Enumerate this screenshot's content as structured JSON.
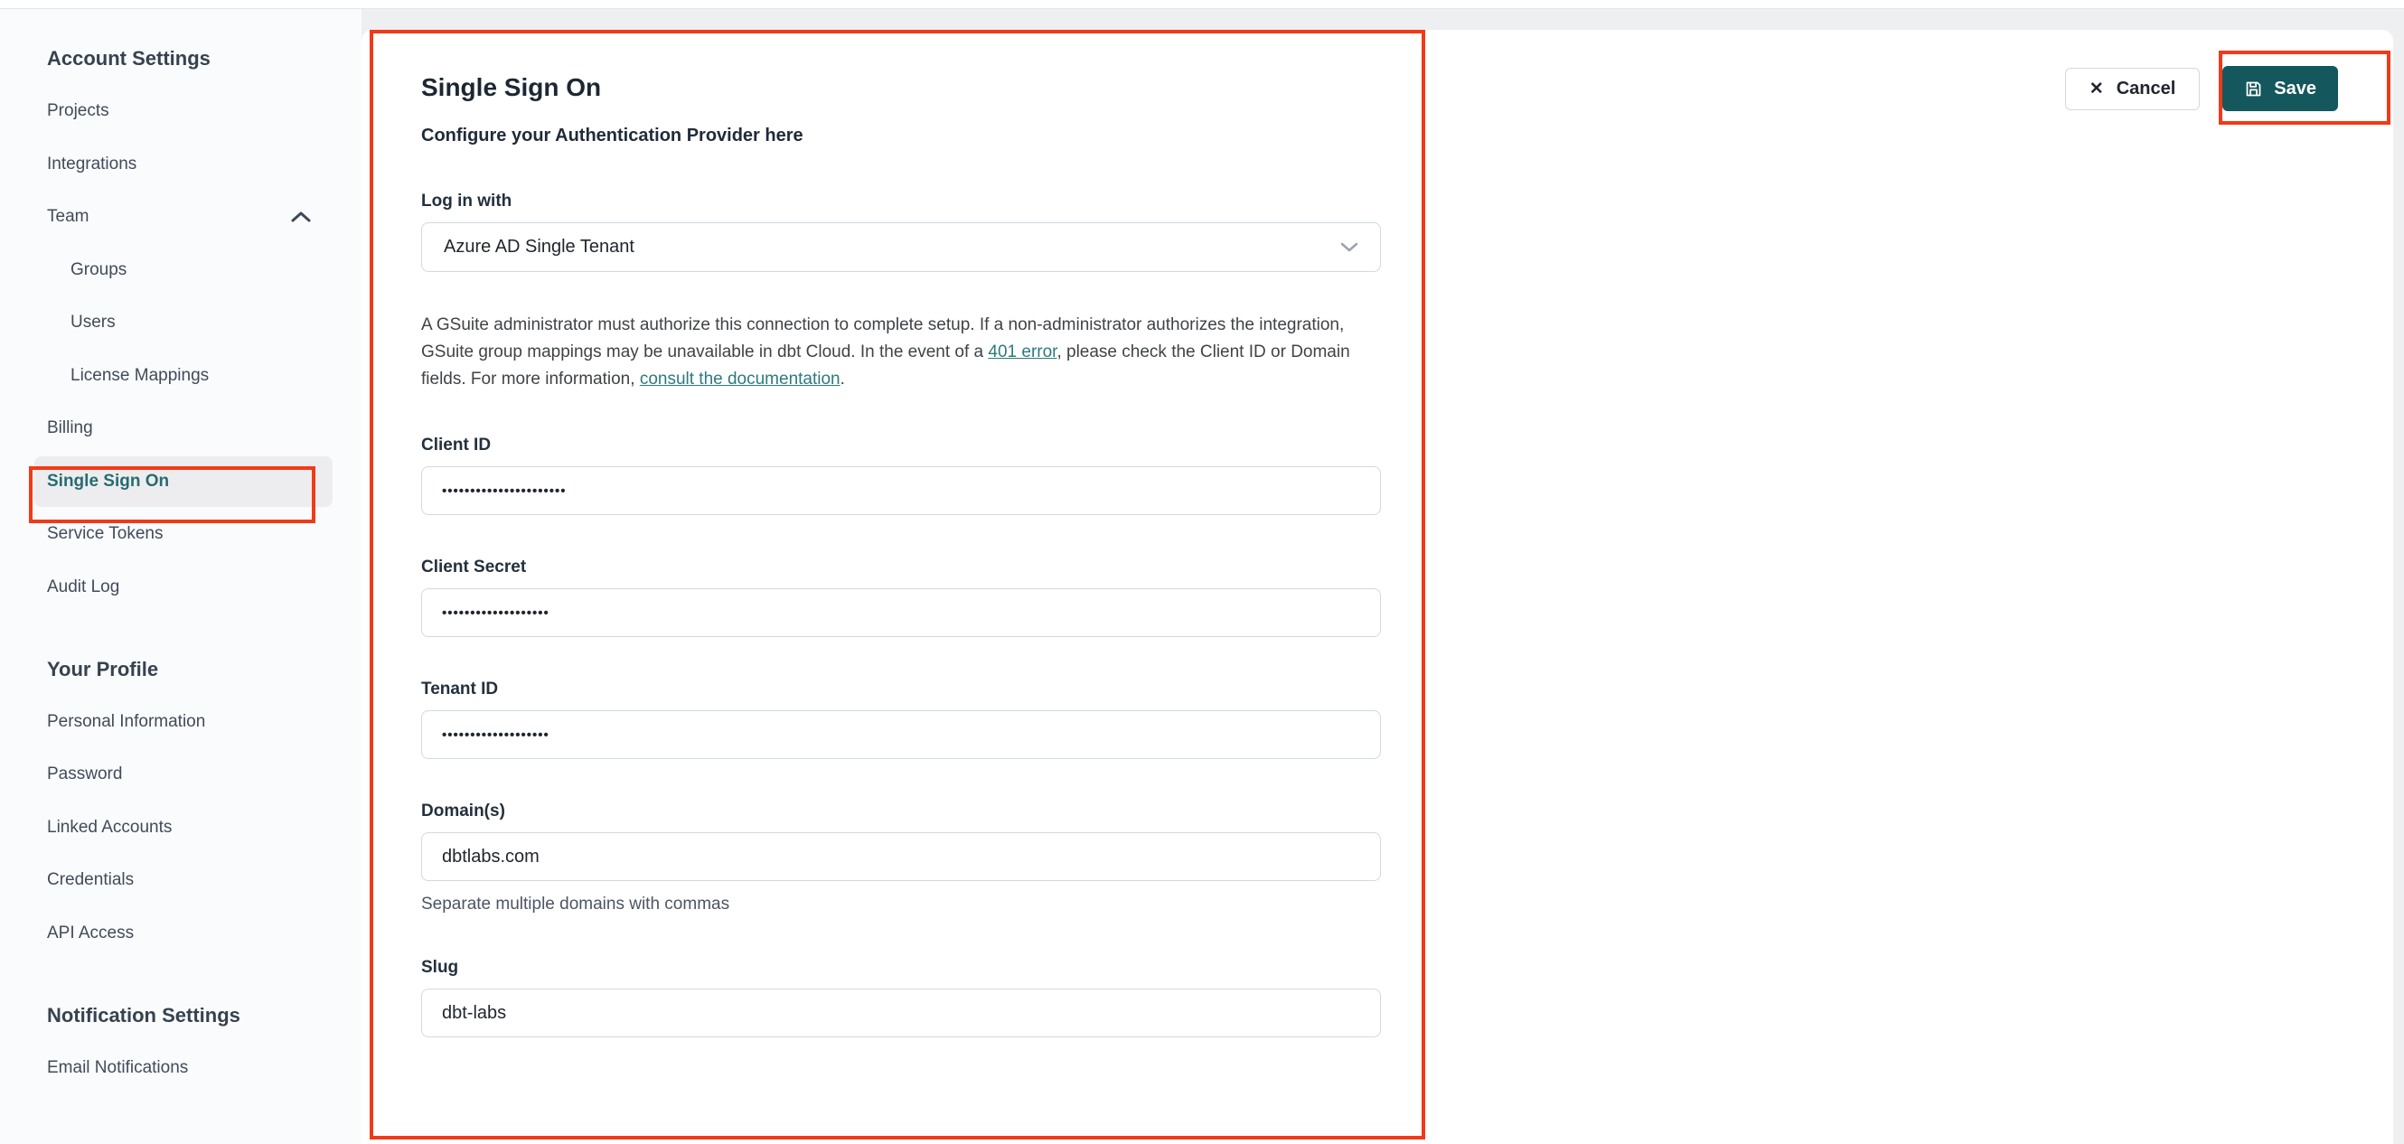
{
  "theme": {
    "accent_teal": "#266c71",
    "accent_dark_teal": "#14575c",
    "link_teal": "#2c7a7e",
    "annotation_red": "#f23a18",
    "page_bg": "#edeff1"
  },
  "sidebar": {
    "sections": [
      {
        "heading": "Account Settings",
        "items": [
          {
            "label": "Projects"
          },
          {
            "label": "Integrations"
          },
          {
            "label": "Team",
            "chevron": "up"
          },
          {
            "label": "Groups",
            "indent": true
          },
          {
            "label": "Users",
            "indent": true
          },
          {
            "label": "License Mappings",
            "indent": true
          },
          {
            "label": "Billing"
          },
          {
            "label": "Single Sign On",
            "active": true
          },
          {
            "label": "Service Tokens"
          },
          {
            "label": "Audit Log"
          }
        ]
      },
      {
        "heading": "Your Profile",
        "items": [
          {
            "label": "Personal Information"
          },
          {
            "label": "Password"
          },
          {
            "label": "Linked Accounts"
          },
          {
            "label": "Credentials"
          },
          {
            "label": "API Access"
          }
        ]
      },
      {
        "heading": "Notification Settings",
        "items": [
          {
            "label": "Email Notifications"
          }
        ]
      }
    ]
  },
  "main": {
    "title": "Single Sign On",
    "subtitle": "Configure your Authentication Provider here",
    "actions": {
      "cancel": "Cancel",
      "save": "Save"
    },
    "form": {
      "login_with": {
        "label": "Log in with",
        "value": "Azure AD Single Tenant"
      },
      "notice": {
        "segments": [
          {
            "text": "A GSuite administrator must authorize this connection to complete setup. If a non-administrator authorizes the integration, GSuite group mappings may be unavailable in dbt Cloud. In the event of a "
          },
          {
            "text": "401 error",
            "link": true,
            "name": "link-401-error"
          },
          {
            "text": ", please check the Client ID or Domain fields. For more information, "
          },
          {
            "text": "consult the documentation",
            "link": true,
            "name": "link-consult-documentation"
          },
          {
            "text": "."
          }
        ]
      },
      "fields": [
        {
          "id": "client-id",
          "label": "Client ID",
          "value": "••••••••••••••••••••••",
          "masked": true
        },
        {
          "id": "client-secret",
          "label": "Client Secret",
          "value": "•••••••••••••••••••",
          "masked": true
        },
        {
          "id": "tenant-id",
          "label": "Tenant ID",
          "value": "•••••••••••••••••••",
          "masked": true
        },
        {
          "id": "domains",
          "label": "Domain(s)",
          "value": "dbtlabs.com",
          "helper": "Separate multiple domains with commas"
        },
        {
          "id": "slug",
          "label": "Slug",
          "value": "dbt-labs"
        }
      ]
    }
  }
}
